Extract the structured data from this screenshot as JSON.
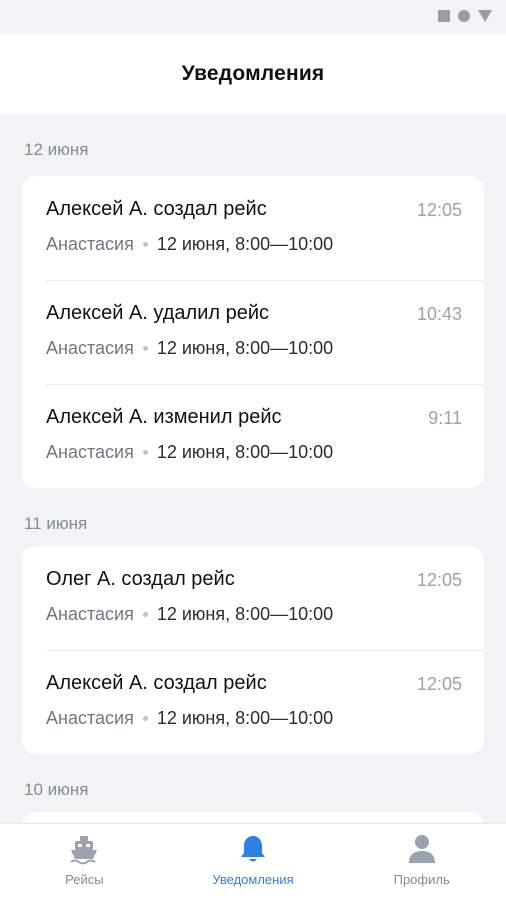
{
  "status_bar": {
    "icons": [
      "stop-square-icon",
      "record-circle-icon",
      "signal-triangle-icon"
    ]
  },
  "header": {
    "title": "Уведомления"
  },
  "groups": [
    {
      "date": "12 июня",
      "items": [
        {
          "title": "Алексей А. создал рейс",
          "time": "12:05",
          "person": "Анастасия",
          "details": "12 июня, 8:00—10:00"
        },
        {
          "title": "Алексей А. удалил рейс",
          "time": "10:43",
          "person": "Анастасия",
          "details": "12 июня, 8:00—10:00"
        },
        {
          "title": "Алексей А. изменил рейс",
          "time": "9:11",
          "person": "Анастасия",
          "details": "12 июня, 8:00—10:00"
        }
      ]
    },
    {
      "date": "11 июня",
      "items": [
        {
          "title": "Олег А. создал рейс",
          "time": "12:05",
          "person": "Анастасия",
          "details": "12 июня, 8:00—10:00"
        },
        {
          "title": "Алексей А. создал рейс",
          "time": "12:05",
          "person": "Анастасия",
          "details": "12 июня, 8:00—10:00"
        }
      ]
    },
    {
      "date": "10 июня",
      "items": []
    }
  ],
  "tabbar": {
    "tabs": [
      {
        "label": "Рейсы",
        "icon": "ship-icon",
        "active": false
      },
      {
        "label": "Уведомления",
        "icon": "bell-icon",
        "active": true
      },
      {
        "label": "Профиль",
        "icon": "user-icon",
        "active": false
      }
    ]
  },
  "colors": {
    "accent": "#2d81e0",
    "muted": "#818c99",
    "background": "#f2f3f5"
  }
}
